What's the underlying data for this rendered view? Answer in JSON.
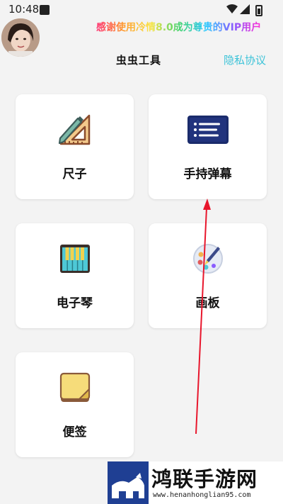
{
  "status_bar": {
    "time": "10:48"
  },
  "header": {
    "vip_message": "感谢使用冷情8.0成为尊贵的VIP用户",
    "title": "虫虫工具",
    "privacy_link": "隐私协议"
  },
  "tools": [
    {
      "label": "尺子",
      "icon": "ruler-icon"
    },
    {
      "label": "手持弹幕",
      "icon": "danmaku-icon"
    },
    {
      "label": "电子琴",
      "icon": "piano-icon"
    },
    {
      "label": "画板",
      "icon": "palette-icon"
    },
    {
      "label": "便签",
      "icon": "sticky-note-icon"
    }
  ],
  "watermark": {
    "name": "鸿联手游网",
    "url": "www.henanhonglian95.com"
  },
  "colors": {
    "accent": "#3cc3d8",
    "annotation_arrow": "#e8162c"
  }
}
